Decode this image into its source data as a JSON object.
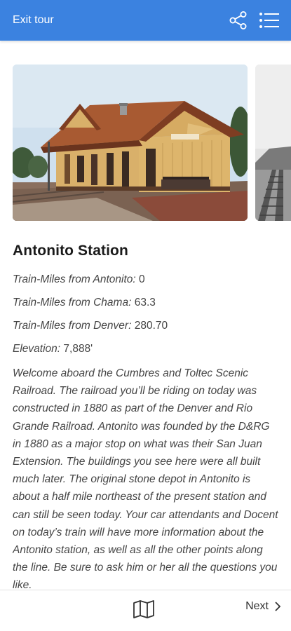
{
  "header": {
    "exit_label": "Exit tour",
    "background": "#3b82e0"
  },
  "icons": {
    "share": "share-icon",
    "list": "list-icon",
    "map": "map-icon",
    "next": "chevron-right-icon"
  },
  "stop": {
    "title": "Antonito Station",
    "facts": [
      {
        "label": "Train-Miles from Antonito:",
        "value": "0"
      },
      {
        "label": "Train-Miles from Chama:",
        "value": "63.3"
      },
      {
        "label": "Train-Miles from Denver:",
        "value": "280.70"
      },
      {
        "label": "Elevation:",
        "value": "7,888'"
      }
    ],
    "description": "Welcome aboard the Cumbres and Toltec Scenic Railroad. The railroad you’ll be riding on today was constructed in 1880 as part of the Denver and Rio Grande Railroad. Antonito was founded by the D&RG in 1880 as a major stop on what was their San Juan Extension. The buildings you see here were all built much later. The original stone depot in Antonito is about a half mile northeast of the present station and can still be seen today. Your car attendants and Docent on today’s train will have more information about the Antonito station, as well as all the other points along the line. Be sure to ask him or her all the questions you like."
  },
  "bottom": {
    "next_label": "Next"
  }
}
